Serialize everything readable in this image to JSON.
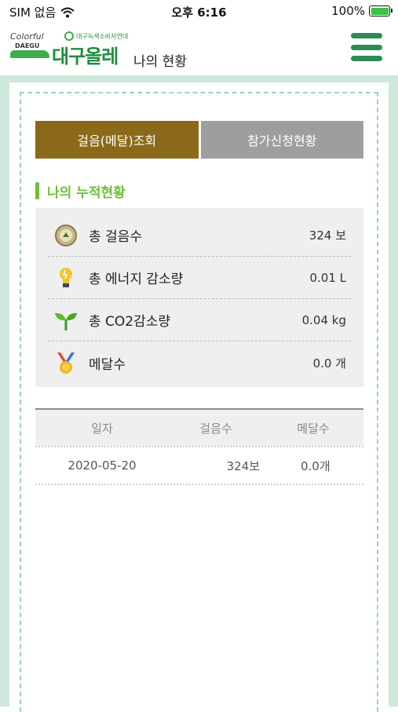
{
  "status_bar": {
    "carrier": "SIM 없음",
    "time": "오후 6:16",
    "battery_percent": "100%",
    "battery_color": "#39c24a"
  },
  "header": {
    "logo_colorful": "Colorful",
    "logo_daegu": "DAEGU",
    "brand_sub": "대구녹색소비자연대",
    "brand_main": "대구올레",
    "page_title": "나의 현황",
    "menu_icon": "hamburger-menu-icon"
  },
  "tabs": [
    {
      "label": "걸음(메달)조회",
      "active": true
    },
    {
      "label": "참가신청현황",
      "active": false
    }
  ],
  "section_title": "나의 누적현황",
  "summary": [
    {
      "icon": "pedometer-icon",
      "label": "총 걸음수",
      "value": "324 보"
    },
    {
      "icon": "lightbulb-icon",
      "label": "총 에너지 감소량",
      "value": "0.01 L"
    },
    {
      "icon": "sprout-icon",
      "label": "총 CO2감소량",
      "value": "0.04 kg"
    },
    {
      "icon": "medal-icon",
      "label": "메달수",
      "value": "0.0 개"
    }
  ],
  "table": {
    "headers": {
      "date": "일자",
      "steps": "걸음수",
      "medals": "메달수"
    },
    "rows": [
      {
        "date": "2020-05-20",
        "steps": "324보",
        "medals": "0.0개"
      }
    ]
  },
  "colors": {
    "accent_green": "#1d8c3a",
    "section_green": "#6fbf3a",
    "tab_active": "#8a6a1a",
    "tab_inactive": "#9e9e9e",
    "frame_bg": "#cfe8dc"
  }
}
